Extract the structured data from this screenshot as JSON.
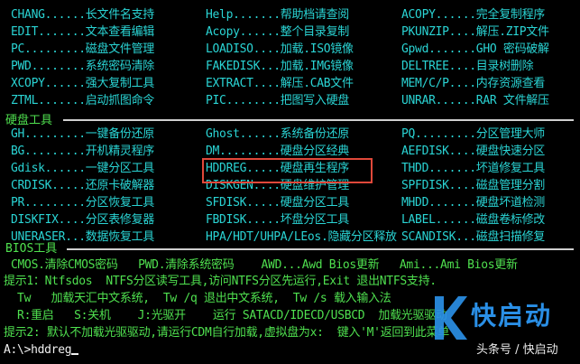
{
  "menu_top": [
    [
      "CHANG......长文件名支持",
      "Help.......帮助档请查阅",
      "ACOPY......完全复制程序"
    ],
    [
      "EDIT.......文本查看编辑",
      "Acopy......整个目录复制",
      "PKUNZIP....解压.ZIP文件"
    ],
    [
      "PC.........磁盘文件管理",
      "LOADISO....加载.ISO镜像",
      "Gpwd.......GHO 密码破解"
    ],
    [
      "PWD........系统密码清除",
      "FAKEDISK...加载.IMG镜像",
      "DELTREE....目录树删除"
    ],
    [
      "XCOPY......强大复制工具",
      "EXTRACT....解压.CAB文件",
      "MEM/C/P....内存资源查看"
    ],
    [
      "ZTML.......启动抓图命令",
      "PIC........把图写入硬盘",
      "UNRAR......RAR 文件解压"
    ]
  ],
  "disk_section": {
    "title": "硬盘工具",
    "rows": [
      [
        "GH.........一键备份还原",
        "Ghost......系统备份还原",
        "PQ.........分区管理大师"
      ],
      [
        "BG.........开机精灵程序",
        "DM.........硬盘分区经典",
        "AEFDISK....硬盘快速分区"
      ],
      [
        "Gdisk......一键分区工具",
        "HDDREG.....硬盘再生程序",
        "THDD.......坏道修复工具"
      ],
      [
        "CRDISK.....还原卡破解器",
        "DISKGEN....硬盘维护管理",
        "SPFDISK....磁盘管理分割"
      ],
      [
        "PR.........分区恢复工具",
        "SFDISK.....硬盘分区工具",
        "MHDD.......硬盘坏道检测"
      ],
      [
        "DISKFIX....分区表修复器",
        "FBDISK.....坏盘分区工具",
        "LABEL......磁盘卷标修改"
      ],
      [
        "UNERASER...数据恢复工具",
        "HPA/HDT/UHPA/LEos.隐藏分区释放",
        "SCANDISK...磁盘扫描修复"
      ]
    ],
    "highlighted": "HDDREG.....硬盘再生程序"
  },
  "bios_section": {
    "title": "BIOS工具",
    "row": "CMOS.清除CMOS密码   PWD.清除系统密码    AWD...Awd Bios更新   Ami...Ami Bios更新"
  },
  "tips": [
    "提示1：Ntfsdos  NTFS分区读写工具,访问NTFS分区先运行,Exit 退出NTFS支持.",
    "  Tw   加载天汇中文系统,  Tw /q 退出中文系统,  Tw /s 载入输入法",
    "  R:重启   S:关机    J:光驱开    运行 SATACD/IDECD/USBCD  加载光驱驱动",
    "提示2: 默认不加载光驱驱动,请运行CDM自行加载,虚拟盘为x:  键入'M'返回到此菜单"
  ],
  "prompt": "A:\\>hddreg",
  "watermark": {
    "brand": "快启动",
    "sub": "头条号 / 快启动",
    "accent": "#2a8fe6"
  },
  "colors": {
    "menu": "#2ad4d4",
    "section": "#4fe04f",
    "highlight_box": "#e0483a"
  }
}
